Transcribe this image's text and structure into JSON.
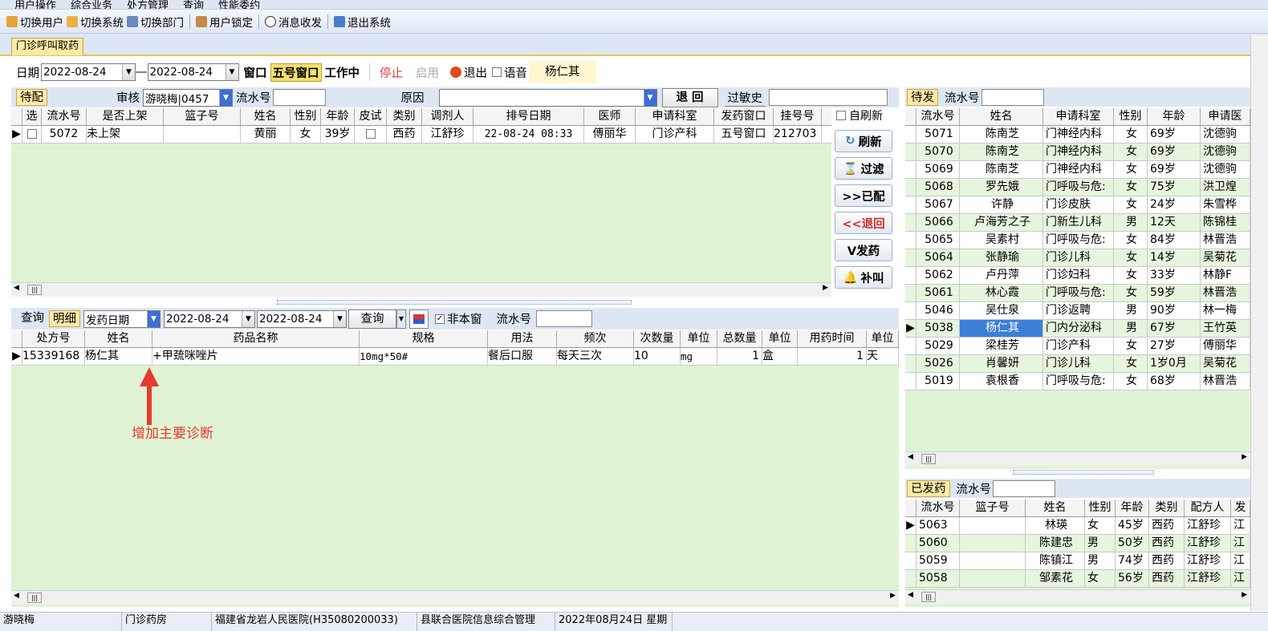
{
  "menubar": [
    "用户操作",
    "综合业务",
    "处方管理",
    "查询",
    "性能委约"
  ],
  "toolbar": {
    "switch_user": "切换用户",
    "switch_system": "切换系统",
    "switch_dept": "切换部门",
    "lock_user": "用户锁定",
    "messages": "消息收发",
    "exit_system": "退出系统"
  },
  "main_tab": "门诊呼叫取药",
  "filter": {
    "date_label": "日期",
    "date_from": "2022-08-24",
    "dash": "—",
    "date_to": "2022-08-24",
    "window_label": "窗口",
    "window_value": "五号窗口",
    "working": "工作中",
    "stop": "停止",
    "enable": "启用",
    "exit": "退出",
    "voice": "语音",
    "patient_name": "杨仁其"
  },
  "pending": {
    "tab": "待配",
    "audit_label": "审核",
    "audit_value": "游晓梅|0457",
    "serial_label": "流水号",
    "reason_label": "原因",
    "return_btn": "退 回",
    "allergy_tab": "过敏史",
    "headers": [
      "选",
      "流水号",
      "是否上架",
      "篮子号",
      "姓名",
      "性别",
      "年龄",
      "皮试",
      "类别",
      "调剂人",
      "排号日期",
      "医师",
      "申请科室",
      "发药窗口",
      "挂号号"
    ],
    "rows": [
      [
        "",
        "5072",
        "未上架",
        "",
        "黄丽",
        "女",
        "39岁",
        "",
        "西药",
        "江舒珍",
        "22-08-24 08:33",
        "傅丽华",
        "门诊产科",
        "五号窗口",
        "212703"
      ]
    ]
  },
  "side_buttons": {
    "auto_refresh": "自刷新",
    "refresh": "刷新",
    "filter": "过滤",
    "dispensed": ">>已配",
    "return": "<<退回",
    "dispense": "V发药",
    "recall": "补叫"
  },
  "detail": {
    "query_tab": "查询",
    "detail_tab": "明细",
    "date_type": "发药日期",
    "date_from": "2022-08-24",
    "date_to": "2022-08-24",
    "query_btn": "查询",
    "not_this_window": "非本窗",
    "serial_label": "流水号",
    "headers": [
      "处方号",
      "姓名",
      "药品名称",
      "规格",
      "用法",
      "频次",
      "次数量",
      "单位",
      "总数量",
      "单位",
      "用药时间",
      "单位"
    ],
    "rows": [
      [
        "15339168",
        "杨仁其",
        "+甲巯咪唑片",
        "10mg*50#",
        "餐后口服",
        "每天三次",
        "10",
        "mg",
        "1",
        "盒",
        "1",
        "天"
      ]
    ],
    "annotation": "增加主要诊断"
  },
  "waiting": {
    "tab": "待发",
    "serial_label": "流水号",
    "headers": [
      "流水号",
      "姓名",
      "申请科室",
      "性别",
      "年龄",
      "申请医"
    ],
    "rows": [
      [
        "5071",
        "陈南芝",
        "门神经内科",
        "女",
        "69岁",
        "沈德驹"
      ],
      [
        "5070",
        "陈南芝",
        "门神经内科",
        "女",
        "69岁",
        "沈德驹"
      ],
      [
        "5069",
        "陈南芝",
        "门神经内科",
        "女",
        "69岁",
        "沈德驹"
      ],
      [
        "5068",
        "罗先娥",
        "门呼吸与危:",
        "女",
        "75岁",
        "洪卫煌"
      ],
      [
        "5067",
        "许静",
        "门诊皮肤",
        "女",
        "24岁",
        "朱雪桦"
      ],
      [
        "5066",
        "卢海芳之子",
        "门新生儿科",
        "男",
        "12天",
        "陈锦桂"
      ],
      [
        "5065",
        "吴素村",
        "门呼吸与危:",
        "女",
        "84岁",
        "林晋浩"
      ],
      [
        "5064",
        "张静瑜",
        "门诊儿科",
        "女",
        "14岁",
        "吴菊花"
      ],
      [
        "5062",
        "卢丹萍",
        "门诊妇科",
        "女",
        "33岁",
        "林静F"
      ],
      [
        "5061",
        "林心霞",
        "门呼吸与危:",
        "女",
        "59岁",
        "林晋浩"
      ],
      [
        "5046",
        "吴仕泉",
        "门诊返聘",
        "男",
        "90岁",
        "林一梅"
      ],
      [
        "5038",
        "杨仁其",
        "门内分泌科",
        "男",
        "67岁",
        "王竹英"
      ],
      [
        "5029",
        "梁桂芳",
        "门诊产科",
        "女",
        "27岁",
        "傅丽华"
      ],
      [
        "5026",
        "肖馨妍",
        "门诊儿科",
        "女",
        "1岁0月",
        "吴菊花"
      ],
      [
        "5019",
        "袁根香",
        "门呼吸与危:",
        "女",
        "68岁",
        "林晋浩"
      ]
    ]
  },
  "dispensed": {
    "tab": "已发药",
    "serial_label": "流水号",
    "headers": [
      "流水号",
      "篮子号",
      "姓名",
      "性别",
      "年龄",
      "类别",
      "配方人",
      "发"
    ],
    "rows": [
      [
        "5063",
        "",
        "林瑛",
        "女",
        "45岁",
        "西药",
        "江舒珍",
        "江"
      ],
      [
        "5060",
        "",
        "陈建忠",
        "男",
        "50岁",
        "西药",
        "江舒珍",
        "江"
      ],
      [
        "5059",
        "",
        "陈镇江",
        "男",
        "74岁",
        "西药",
        "江舒珍",
        "江"
      ],
      [
        "5058",
        "",
        "邹素花",
        "女",
        "56岁",
        "西药",
        "江舒珍",
        "江"
      ]
    ]
  },
  "status": [
    "游晓梅",
    "门诊药房",
    "福建省龙岩人民医院(H35080200033)",
    "县联合医院信息综合管理",
    "2022年08月24日 星期"
  ]
}
